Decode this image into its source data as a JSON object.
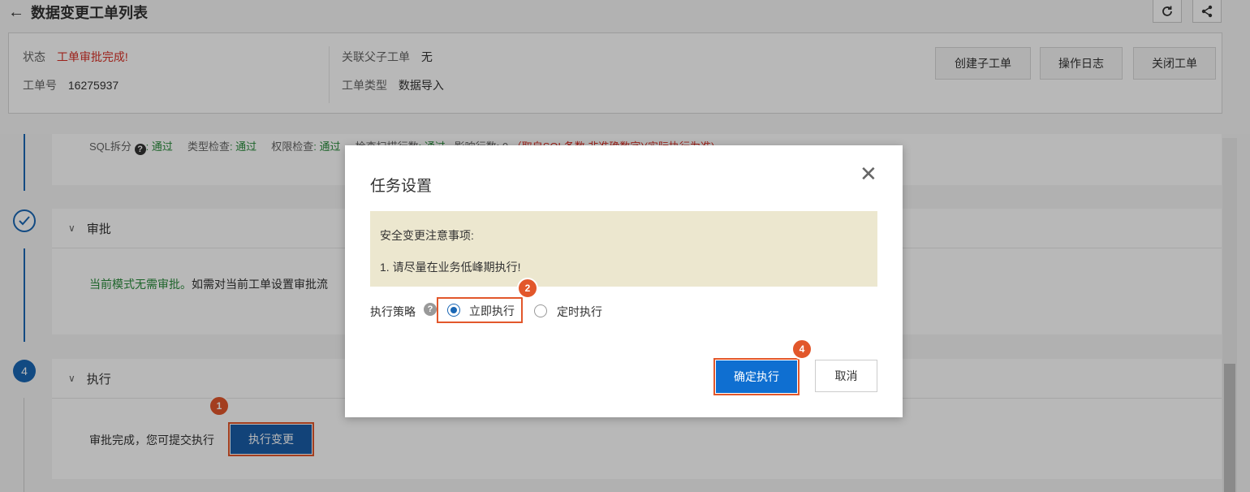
{
  "header": {
    "back_label": "数据变更工单列表",
    "refresh_icon": "refresh-icon",
    "share_icon": "share-icon"
  },
  "info": {
    "status_label": "状态",
    "status_value": "工单审批完成!",
    "ticket_no_label": "工单号",
    "ticket_no_value": "16275937",
    "parent_label": "关联父子工单",
    "parent_value": "无",
    "type_label": "工单类型",
    "type_value": "数据导入",
    "buttons": [
      "创建子工单",
      "操作日志",
      "关闭工单"
    ]
  },
  "checks": {
    "sql_split_label": "SQL拆分",
    "sql_split_value": ": 通过",
    "type_check_label": "类型检查",
    "type_check_value": ": 通过",
    "perm_check_label": "权限检查",
    "perm_check_value": ": 通过",
    "scan_rows_label": "检查扫描行数",
    "scan_rows_value": ": 通过",
    "affected_rows": "影响行数: 0",
    "note": "（取自SQL备数,非准确数字)(实际执行为准)"
  },
  "approval": {
    "title": "审批",
    "text_green": "当前模式无需审批。",
    "text_rest": "如需对当前工单设置审批流"
  },
  "execute": {
    "step_number": "4",
    "title": "执行",
    "status_text": "审批完成，您可提交执行",
    "button": "执行变更"
  },
  "badges": [
    "1",
    "2",
    "4"
  ],
  "modal": {
    "title": "任务设置",
    "close_icon": "close-icon",
    "notice_title": "安全变更注意事项:",
    "notice_item": "1. 请尽量在业务低峰期执行!",
    "strategy_label": "执行策略",
    "options": [
      "立即执行",
      "定时执行"
    ],
    "selected_option": "立即执行",
    "confirm": "确定执行",
    "cancel": "取消"
  },
  "colors": {
    "accent": "#1a67b5",
    "primary_button": "#0f6fd1",
    "annotation": "#e2572b",
    "error_text": "#d93026",
    "pass_text": "#2a8c3c",
    "notice_bg": "#ece7cf"
  }
}
